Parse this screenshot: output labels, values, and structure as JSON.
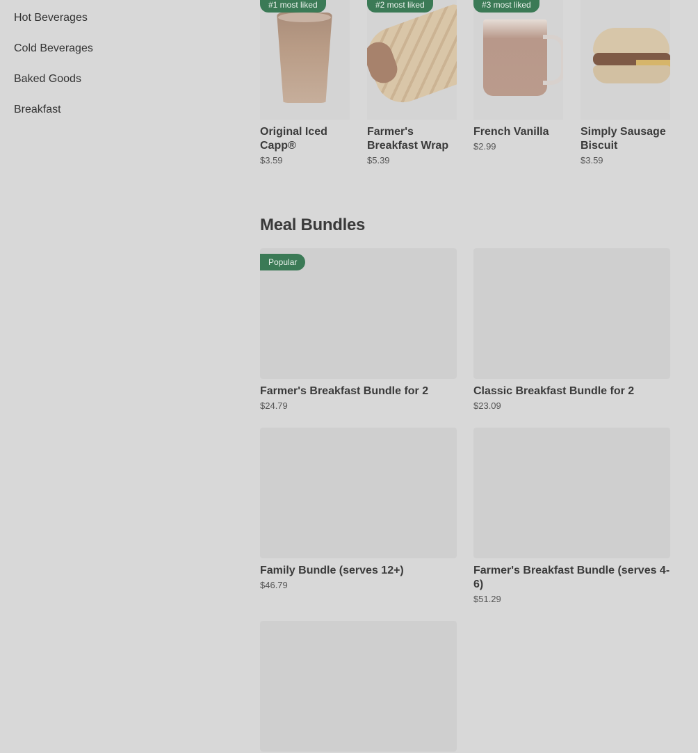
{
  "sidebar": {
    "items": [
      {
        "label": "Hot Beverages"
      },
      {
        "label": "Cold Beverages"
      },
      {
        "label": "Baked Goods"
      },
      {
        "label": "Breakfast"
      }
    ]
  },
  "most_liked": [
    {
      "badge": "#1 most liked",
      "title": "Original Iced Capp®",
      "price": "$3.59",
      "image_icon": "iced-capp-cup-icon"
    },
    {
      "badge": "#2 most liked",
      "title": "Farmer's Breakfast Wrap",
      "price": "$5.39",
      "image_icon": "breakfast-wrap-icon"
    },
    {
      "badge": "#3 most liked",
      "title": "French Vanilla",
      "price": "$2.99",
      "image_icon": "vanilla-mug-icon"
    },
    {
      "badge": "",
      "title": "Simply Sausage Biscuit",
      "price": "$3.59",
      "image_icon": "sausage-biscuit-icon"
    }
  ],
  "meal_bundles": {
    "title": "Meal Bundles",
    "items": [
      {
        "badge": "Popular",
        "title": "Farmer's Breakfast Bundle for 2",
        "price": "$24.79"
      },
      {
        "badge": "",
        "title": "Classic Breakfast Bundle for 2",
        "price": "$23.09"
      },
      {
        "badge": "",
        "title": "Family Bundle (serves 12+)",
        "price": "$46.79"
      },
      {
        "badge": "",
        "title": "Farmer's Breakfast Bundle (serves 4-6)",
        "price": "$51.29"
      },
      {
        "badge": "",
        "title": "",
        "price": ""
      }
    ]
  },
  "colors": {
    "badge_bg": "#3b7a56",
    "page_bg": "#d8d8d8",
    "placeholder_bg": "#cfcfcf"
  }
}
